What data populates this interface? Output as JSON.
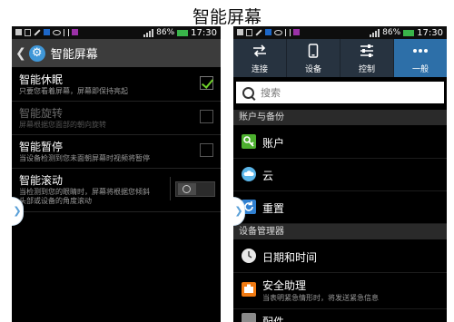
{
  "page_title": "智能屏幕",
  "left": {
    "status": {
      "battery": "86%",
      "time": "17:30"
    },
    "header_title": "智能屏幕",
    "settings": [
      {
        "title": "智能休眠",
        "desc": "只要您看着屏幕，屏幕即保持亮起",
        "control": "checkbox",
        "checked": true,
        "enabled": true
      },
      {
        "title": "智能旋转",
        "desc": "屏幕根据您面部的朝向旋转",
        "control": "checkbox",
        "checked": false,
        "enabled": false
      },
      {
        "title": "智能暂停",
        "desc": "当设备检测到您未面朝屏幕时视频将暂停",
        "control": "checkbox",
        "checked": false,
        "enabled": true
      },
      {
        "title": "智能滚动",
        "desc_line1": "当检测到您的眼睛时，屏幕将根据您倾斜",
        "desc_line2": "头部或设备的角度滚动",
        "control": "toggle",
        "on": false,
        "enabled": true
      }
    ]
  },
  "right": {
    "status": {
      "battery": "86%",
      "time": "17:30"
    },
    "tabs": [
      {
        "label": "连接",
        "icon": "arrows-icon"
      },
      {
        "label": "设备",
        "icon": "device-icon"
      },
      {
        "label": "控制",
        "icon": "sliders-icon"
      },
      {
        "label": "一般",
        "icon": "dots-icon",
        "active": true
      }
    ],
    "search_placeholder": "搜索",
    "section_accounts": "账户与备份",
    "item_account": "账户",
    "item_cloud": "云",
    "item_reset": "重置",
    "section_device_manager": "设备管理器",
    "item_datetime": "日期和时间",
    "item_safety": "安全助理",
    "item_safety_sub": "当表明紧急情形时，将发送紧急信息",
    "item_partial": "配件"
  },
  "colors": {
    "accent_blue": "#2d6fa8",
    "check_green": "#6fd12a",
    "gear_blue": "#3f97d8",
    "account_green": "#4caf2e",
    "safety_orange": "#f07a12"
  }
}
